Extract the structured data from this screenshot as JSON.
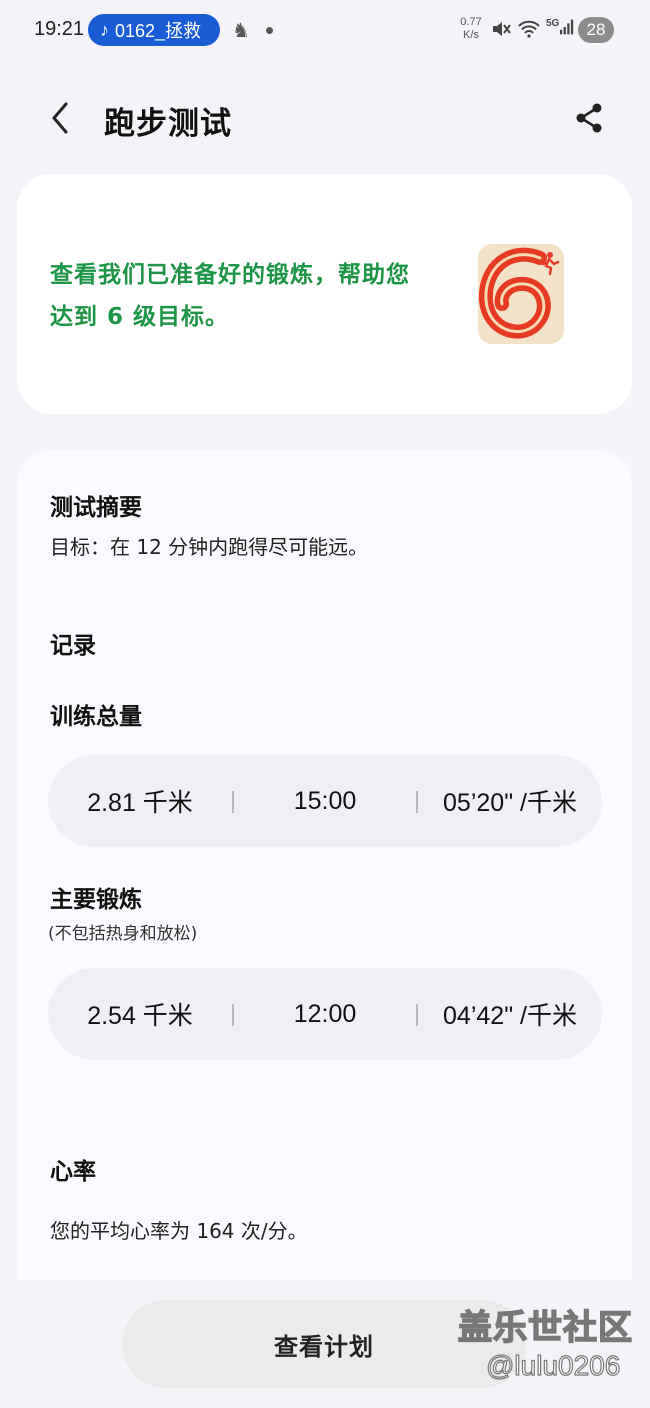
{
  "status_bar": {
    "time": "19:21",
    "media_pill": "0162_拯救",
    "speed_value": "0.77",
    "speed_unit": "K/s",
    "network": "5G",
    "battery": "28"
  },
  "header": {
    "title": "跑步测试"
  },
  "hero": {
    "text": "查看我们已准备好的锻炼，帮助您达到 6 级目标。",
    "badge_number": "6",
    "accent_color": "#1e9446",
    "badge_color": "#e63a25"
  },
  "summary": {
    "heading": "测试摘要",
    "goal": "目标：在 12 分钟内跑得尽可能远。"
  },
  "records": {
    "heading": "记录",
    "total": {
      "heading": "训练总量",
      "distance": "2.81 千米",
      "duration": "15:00",
      "pace": "05’20\" /千米"
    },
    "main": {
      "heading": "主要锻炼",
      "note": "(不包括热身和放松)",
      "distance": "2.54 千米",
      "duration": "12:00",
      "pace": "04’42\" /千米"
    }
  },
  "heart_rate": {
    "heading": "心率",
    "text": "您的平均心率为 164 次/分。"
  },
  "footer": {
    "plan_button": "查看计划"
  },
  "watermark": {
    "line1": "盖乐世社区",
    "line2": "@lulu0206"
  }
}
